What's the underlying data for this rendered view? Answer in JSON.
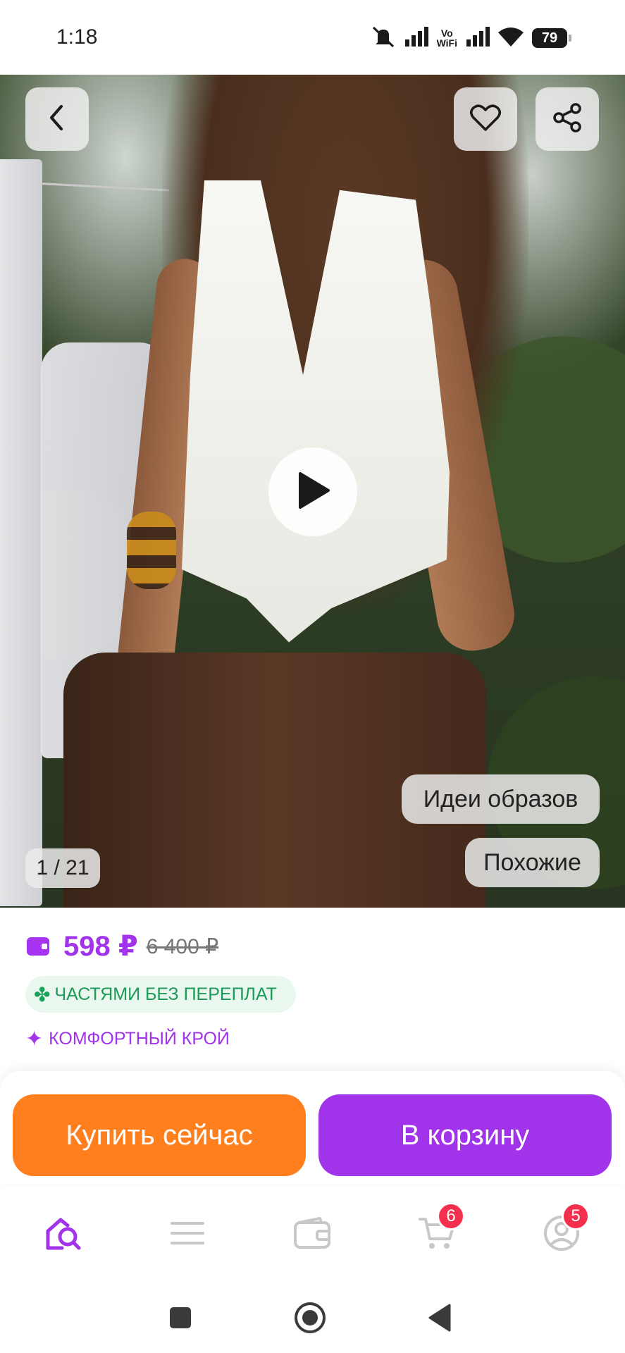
{
  "status_bar": {
    "time": "1:18",
    "vowifi_top": "Vo",
    "vowifi_bottom": "WiFi",
    "battery": "79",
    "icons": [
      "mute-icon",
      "signal-icon",
      "vowifi-icon",
      "signal-icon",
      "wifi-icon",
      "battery-icon"
    ]
  },
  "gallery": {
    "counter": "1 / 21",
    "ideas_label": "Идеи образов",
    "similar_label": "Похожие",
    "icons": [
      "back-icon",
      "heart-icon",
      "share-icon",
      "play-icon"
    ]
  },
  "product": {
    "price": "598 ₽",
    "old_price": "6 400 ₽",
    "installments_badge": "ЧАСТЯМИ БЕЗ ПЕРЕПЛАТ",
    "comfort_badge": "КОМФОРТНЫЙ КРОЙ"
  },
  "actions": {
    "buy_now": "Купить сейчас",
    "add_to_cart": "В корзину"
  },
  "bottom_nav": {
    "items": [
      {
        "icon": "home-search-icon",
        "active": true
      },
      {
        "icon": "catalog-icon",
        "active": false
      },
      {
        "icon": "wallet-icon",
        "active": false
      },
      {
        "icon": "cart-icon",
        "active": false,
        "badge": "6"
      },
      {
        "icon": "profile-icon",
        "active": false,
        "badge": "5"
      }
    ]
  },
  "colors": {
    "accent_purple": "#a133ea",
    "accent_orange": "#ff7f1f",
    "badge_red": "#f5304e",
    "installments_green": "#1e9a58"
  }
}
